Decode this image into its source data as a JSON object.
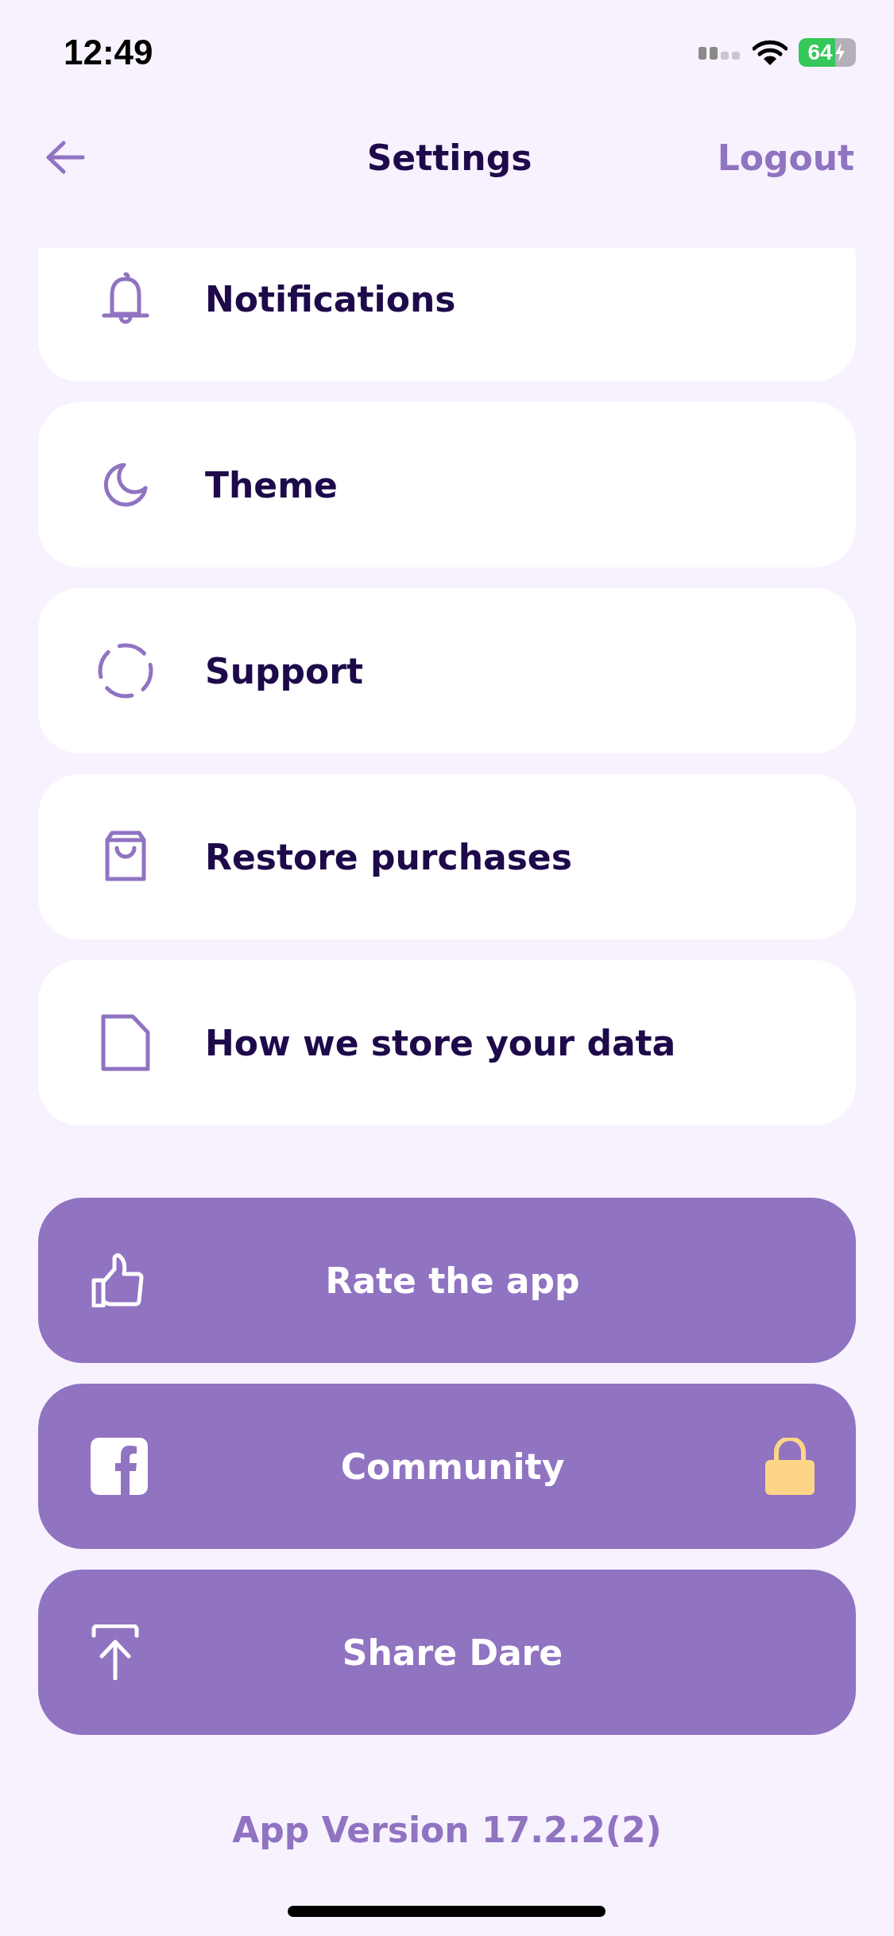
{
  "status_bar": {
    "time": "12:49",
    "battery": "64"
  },
  "header": {
    "title": "Settings",
    "action": "Logout"
  },
  "items": [
    {
      "label": "Notifications",
      "kind": "bell"
    },
    {
      "label": "Theme",
      "kind": "moon"
    },
    {
      "label": "Support",
      "kind": "ring"
    },
    {
      "label": "Restore purchases",
      "kind": "bag"
    },
    {
      "label": "How we store your data",
      "kind": "doc"
    }
  ],
  "buttons": [
    {
      "label": "Rate the app",
      "kind": "thumb",
      "locked": false
    },
    {
      "label": "Community",
      "kind": "facebook",
      "locked": true
    },
    {
      "label": "Share Dare",
      "kind": "share",
      "locked": false
    }
  ],
  "version": "App Version 17.2.2(2)"
}
